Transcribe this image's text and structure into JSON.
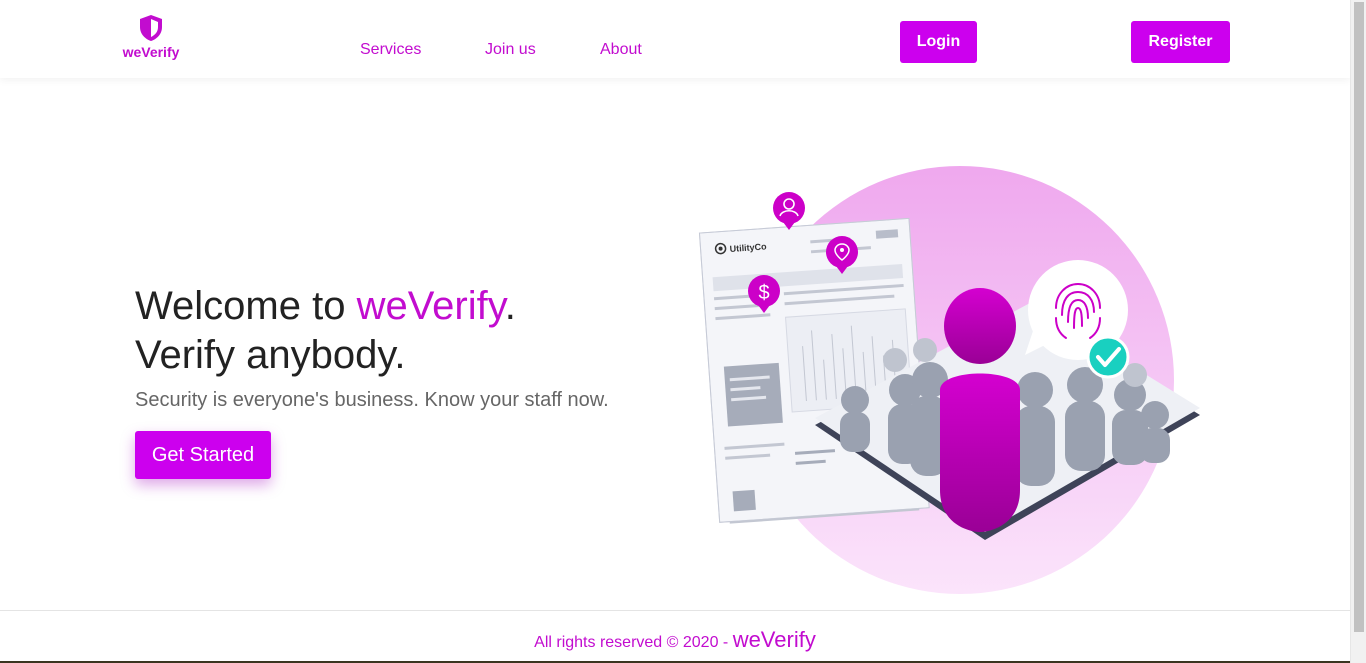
{
  "header": {
    "logo_text": "weVerify",
    "nav": [
      "Services",
      "Join us",
      "About"
    ],
    "login_label": "Login",
    "register_label": "Register"
  },
  "hero": {
    "title_prefix": "Welcome to ",
    "title_brand": "weVerify",
    "title_suffix": ".",
    "title_line2": "Verify anybody.",
    "subtitle": "Security is everyone's business. Know your staff now.",
    "cta_label": "Get Started"
  },
  "illustration": {
    "document_company": "UtilityCo"
  },
  "footer": {
    "text": "All rights reserved © 2020 - ",
    "brand": "weVerify"
  },
  "colors": {
    "brand": "#cc00ee",
    "brand_text": "#c20ccf",
    "teal": "#19d0c0"
  }
}
